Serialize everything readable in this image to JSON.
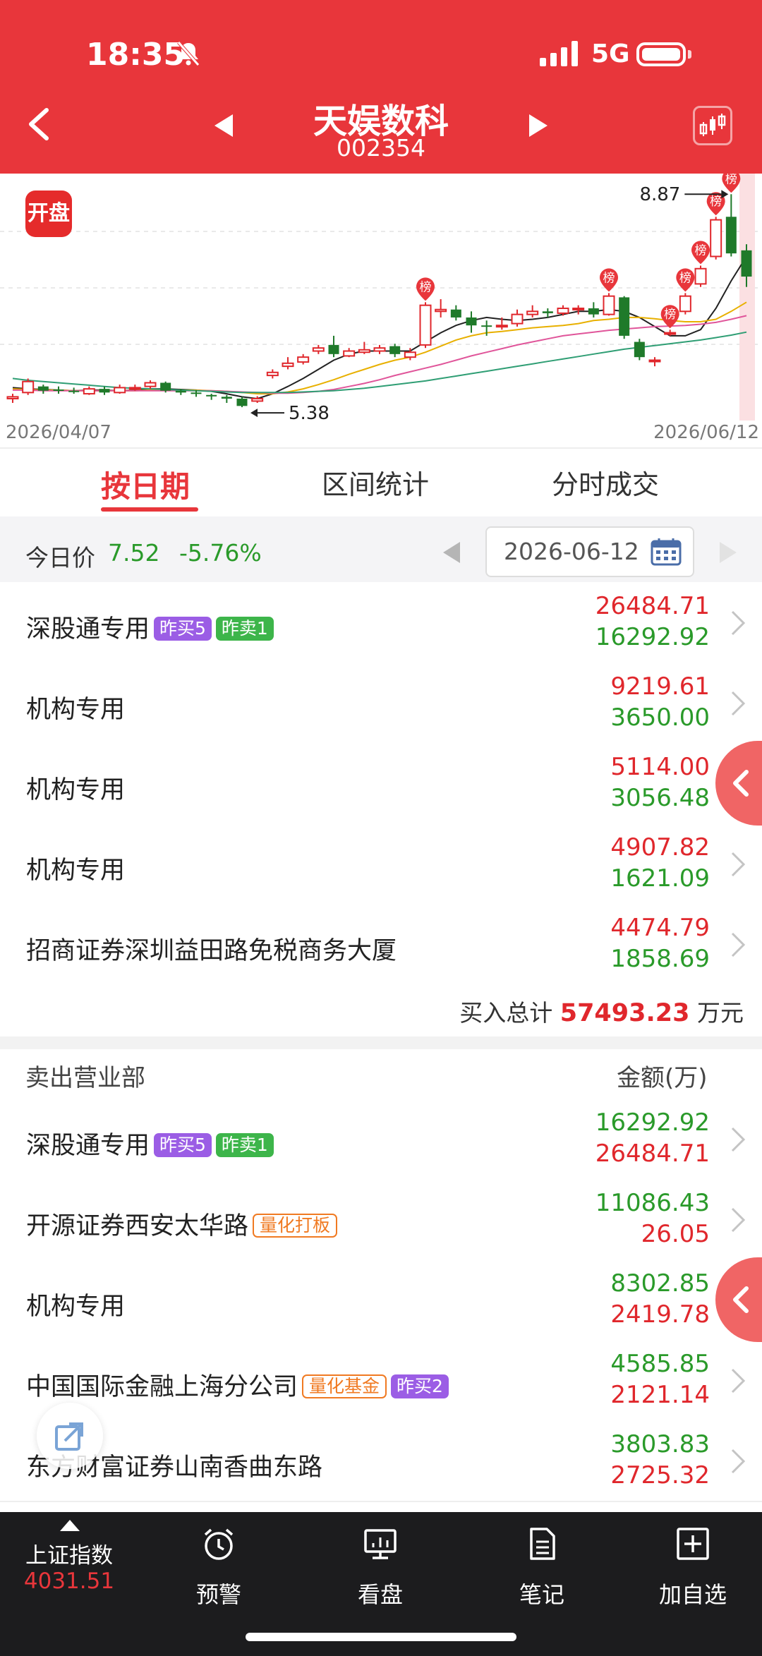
{
  "status": {
    "time": "18:35",
    "network": "5G"
  },
  "header": {
    "name": "天娱数科",
    "code": "002354"
  },
  "chart": {
    "badge": "开盘",
    "start_date": "2026/04/07",
    "end_date": "2026/06/12",
    "high_label": "8.87",
    "low_label": "5.38",
    "tag_text": "榜"
  },
  "chart_data": {
    "type": "candlestick",
    "x_range": [
      "2026/04/07",
      "2026/06/12"
    ],
    "annotations": [
      {
        "text": "8.87",
        "kind": "high"
      },
      {
        "text": "5.38",
        "kind": "low"
      }
    ],
    "candles": [
      {
        "o": 5.52,
        "c": 5.55,
        "h": 5.6,
        "l": 5.45
      },
      {
        "o": 5.62,
        "c": 5.8,
        "h": 5.85,
        "l": 5.58
      },
      {
        "o": 5.72,
        "c": 5.65,
        "h": 5.75,
        "l": 5.6
      },
      {
        "o": 5.67,
        "c": 5.65,
        "h": 5.72,
        "l": 5.6
      },
      {
        "o": 5.65,
        "c": 5.63,
        "h": 5.7,
        "l": 5.6
      },
      {
        "o": 5.6,
        "c": 5.68,
        "h": 5.72,
        "l": 5.58
      },
      {
        "o": 5.68,
        "c": 5.62,
        "h": 5.72,
        "l": 5.58
      },
      {
        "o": 5.62,
        "c": 5.7,
        "h": 5.75,
        "l": 5.6
      },
      {
        "o": 5.7,
        "c": 5.7,
        "h": 5.75,
        "l": 5.65
      },
      {
        "o": 5.72,
        "c": 5.78,
        "h": 5.82,
        "l": 5.68
      },
      {
        "o": 5.78,
        "c": 5.65,
        "h": 5.8,
        "l": 5.62
      },
      {
        "o": 5.65,
        "c": 5.62,
        "h": 5.68,
        "l": 5.58
      },
      {
        "o": 5.62,
        "c": 5.6,
        "h": 5.66,
        "l": 5.55
      },
      {
        "o": 5.58,
        "c": 5.56,
        "h": 5.6,
        "l": 5.5
      },
      {
        "o": 5.55,
        "c": 5.52,
        "h": 5.58,
        "l": 5.45
      },
      {
        "o": 5.52,
        "c": 5.4,
        "h": 5.55,
        "l": 5.38
      },
      {
        "o": 5.48,
        "c": 5.52,
        "h": 5.56,
        "l": 5.45
      },
      {
        "o": 5.9,
        "c": 5.95,
        "h": 6.0,
        "l": 5.85
      },
      {
        "o": 6.05,
        "c": 6.1,
        "h": 6.2,
        "l": 6.0
      },
      {
        "o": 6.12,
        "c": 6.2,
        "h": 6.25,
        "l": 6.08
      },
      {
        "o": 6.3,
        "c": 6.35,
        "h": 6.4,
        "l": 6.25
      },
      {
        "o": 6.4,
        "c": 6.25,
        "h": 6.55,
        "l": 6.2
      },
      {
        "o": 6.22,
        "c": 6.3,
        "h": 6.35,
        "l": 6.2
      },
      {
        "o": 6.28,
        "c": 6.32,
        "h": 6.45,
        "l": 6.25
      },
      {
        "o": 6.3,
        "c": 6.35,
        "h": 6.4,
        "l": 6.25
      },
      {
        "o": 6.38,
        "c": 6.25,
        "h": 6.42,
        "l": 6.2
      },
      {
        "o": 6.2,
        "c": 6.28,
        "h": 6.35,
        "l": 6.15
      },
      {
        "o": 6.4,
        "c": 7.05,
        "h": 7.1,
        "l": 6.35
      },
      {
        "o": 6.95,
        "c": 6.98,
        "h": 7.15,
        "l": 6.85
      },
      {
        "o": 6.98,
        "c": 6.85,
        "h": 7.05,
        "l": 6.8
      },
      {
        "o": 6.85,
        "c": 6.72,
        "h": 6.95,
        "l": 6.6
      },
      {
        "o": 6.72,
        "c": 6.7,
        "h": 6.8,
        "l": 6.55
      },
      {
        "o": 6.72,
        "c": 6.72,
        "h": 6.85,
        "l": 6.65
      },
      {
        "o": 6.75,
        "c": 6.9,
        "h": 6.98,
        "l": 6.7
      },
      {
        "o": 6.9,
        "c": 6.95,
        "h": 7.05,
        "l": 6.85
      },
      {
        "o": 6.95,
        "c": 6.92,
        "h": 7.0,
        "l": 6.85
      },
      {
        "o": 6.92,
        "c": 7.0,
        "h": 7.05,
        "l": 6.88
      },
      {
        "o": 6.98,
        "c": 7.0,
        "h": 7.05,
        "l": 6.9
      },
      {
        "o": 7.0,
        "c": 6.9,
        "h": 7.1,
        "l": 6.85
      },
      {
        "o": 6.9,
        "c": 7.2,
        "h": 7.25,
        "l": 6.88
      },
      {
        "o": 7.18,
        "c": 6.55,
        "h": 7.2,
        "l": 6.5
      },
      {
        "o": 6.45,
        "c": 6.2,
        "h": 6.5,
        "l": 6.15
      },
      {
        "o": 6.15,
        "c": 6.15,
        "h": 6.2,
        "l": 6.05
      },
      {
        "o": 6.6,
        "c": 6.6,
        "h": 6.65,
        "l": 6.55
      },
      {
        "o": 6.95,
        "c": 7.2,
        "h": 7.25,
        "l": 6.9
      },
      {
        "o": 7.4,
        "c": 7.65,
        "h": 7.7,
        "l": 7.35
      },
      {
        "o": 7.85,
        "c": 8.45,
        "h": 8.5,
        "l": 7.8
      },
      {
        "o": 8.5,
        "c": 7.9,
        "h": 8.87,
        "l": 7.85
      },
      {
        "o": 7.95,
        "c": 7.52,
        "h": 8.05,
        "l": 7.35
      }
    ],
    "ma": [
      {
        "name": "MA5",
        "color": "#222222",
        "values": [
          5.7,
          5.68,
          5.67,
          5.66,
          5.65,
          5.66,
          5.66,
          5.65,
          5.66,
          5.68,
          5.68,
          5.67,
          5.66,
          5.64,
          5.6,
          5.55,
          5.52,
          5.6,
          5.72,
          5.85,
          6.0,
          6.15,
          6.25,
          6.3,
          6.3,
          6.3,
          6.3,
          6.45,
          6.6,
          6.72,
          6.8,
          6.85,
          6.82,
          6.8,
          6.82,
          6.85,
          6.9,
          6.95,
          6.95,
          6.98,
          6.95,
          6.85,
          6.7,
          6.55,
          6.55,
          6.65,
          7.0,
          7.45,
          7.85
        ]
      },
      {
        "name": "MA10",
        "color": "#e8b000",
        "values": [
          5.68,
          5.67,
          5.66,
          5.66,
          5.65,
          5.65,
          5.65,
          5.65,
          5.65,
          5.66,
          5.66,
          5.66,
          5.66,
          5.65,
          5.64,
          5.62,
          5.6,
          5.6,
          5.63,
          5.68,
          5.75,
          5.83,
          5.92,
          6.0,
          6.08,
          6.15,
          6.2,
          6.28,
          6.38,
          6.48,
          6.55,
          6.6,
          6.62,
          6.65,
          6.68,
          6.7,
          6.72,
          6.75,
          6.8,
          6.82,
          6.85,
          6.85,
          6.83,
          6.8,
          6.78,
          6.78,
          6.82,
          6.95,
          7.1
        ]
      },
      {
        "name": "MA20",
        "color": "#e0559a",
        "values": [
          5.66,
          5.66,
          5.65,
          5.65,
          5.65,
          5.65,
          5.65,
          5.65,
          5.65,
          5.65,
          5.65,
          5.65,
          5.65,
          5.65,
          5.64,
          5.63,
          5.62,
          5.61,
          5.61,
          5.62,
          5.64,
          5.67,
          5.72,
          5.77,
          5.83,
          5.9,
          5.96,
          6.02,
          6.08,
          6.15,
          6.22,
          6.28,
          6.34,
          6.4,
          6.45,
          6.5,
          6.55,
          6.58,
          6.61,
          6.64,
          6.66,
          6.68,
          6.7,
          6.71,
          6.72,
          6.74,
          6.77,
          6.82,
          6.88
        ]
      },
      {
        "name": "MA60",
        "color": "#2f9e74",
        "values": [
          5.85,
          5.82,
          5.8,
          5.78,
          5.76,
          5.74,
          5.72,
          5.7,
          5.69,
          5.68,
          5.67,
          5.66,
          5.65,
          5.64,
          5.63,
          5.62,
          5.62,
          5.62,
          5.62,
          5.63,
          5.64,
          5.65,
          5.67,
          5.69,
          5.72,
          5.75,
          5.78,
          5.81,
          5.85,
          5.89,
          5.93,
          5.97,
          6.01,
          6.05,
          6.09,
          6.13,
          6.17,
          6.21,
          6.25,
          6.29,
          6.33,
          6.36,
          6.39,
          6.42,
          6.45,
          6.48,
          6.52,
          6.56,
          6.61
        ]
      }
    ],
    "tagged_indices": [
      27,
      39,
      43,
      44,
      45,
      46,
      47
    ]
  },
  "tabs": [
    {
      "label": "按日期"
    },
    {
      "label": "区间统计"
    },
    {
      "label": "分时成交"
    }
  ],
  "price": {
    "label": "今日价",
    "value": "7.52",
    "change": "-5.76%",
    "date": "2026-06-12"
  },
  "buy_rows": [
    {
      "name": "深股通专用",
      "tags": [
        {
          "text": "昨买5",
          "style": "purple"
        },
        {
          "text": "昨卖1",
          "style": "green"
        }
      ],
      "v1": "26484.71",
      "v2": "16292.92"
    },
    {
      "name": "机构专用",
      "tags": [],
      "v1": "9219.61",
      "v2": "3650.00"
    },
    {
      "name": "机构专用",
      "tags": [],
      "v1": "5114.00",
      "v2": "3056.48"
    },
    {
      "name": "机构专用",
      "tags": [],
      "v1": "4907.82",
      "v2": "1621.09"
    },
    {
      "name": "招商证券深圳益田路免税商务大厦",
      "tags": [],
      "v1": "4474.79",
      "v2": "1858.69"
    }
  ],
  "buy_total": {
    "label": "买入总计",
    "value": "57493.23",
    "unit": "万元"
  },
  "sell_header": {
    "left": "卖出营业部",
    "right": "金额(万)"
  },
  "sell_rows": [
    {
      "name": "深股通专用",
      "tags": [
        {
          "text": "昨买5",
          "style": "purple"
        },
        {
          "text": "昨卖1",
          "style": "green"
        }
      ],
      "v1": "16292.92",
      "v2": "26484.71"
    },
    {
      "name": "开源证券西安太华路",
      "tags": [
        {
          "text": "量化打板",
          "style": "orange"
        }
      ],
      "v1": "11086.43",
      "v2": "26.05"
    },
    {
      "name": "机构专用",
      "tags": [],
      "v1": "8302.85",
      "v2": "2419.78"
    },
    {
      "name": "中国国际金融上海分公司",
      "tags": [
        {
          "text": "量化基金",
          "style": "orange"
        },
        {
          "text": "昨买2",
          "style": "purple"
        }
      ],
      "v1": "4585.85",
      "v2": "2121.14"
    },
    {
      "name": "东方财富证券山南香曲东路",
      "tags": [],
      "v1": "3803.83",
      "v2": "2725.32"
    }
  ],
  "bottom_nav": {
    "index_name": "上证指数",
    "index_value": "4031.51",
    "items": [
      {
        "label": "预警",
        "icon": "alarm-clock-icon"
      },
      {
        "label": "看盘",
        "icon": "monitor-icon"
      },
      {
        "label": "笔记",
        "icon": "note-icon"
      },
      {
        "label": "加自选",
        "icon": "add-icon"
      }
    ]
  },
  "colors": {
    "header": "#e8363b",
    "up": "#e0272c",
    "down": "#2a9a2a"
  }
}
